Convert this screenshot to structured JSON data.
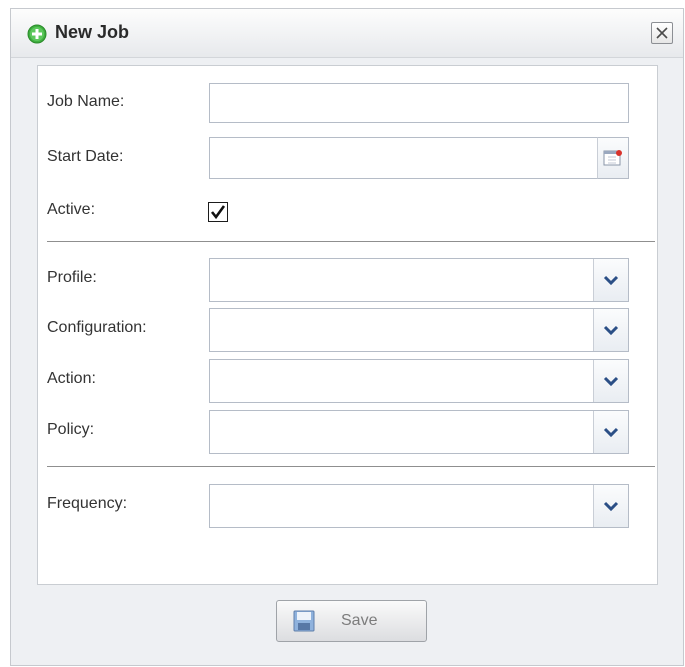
{
  "dialog": {
    "title": "New Job",
    "icon": "add-circle-icon",
    "close_icon": "close-icon"
  },
  "form": {
    "job_name": {
      "label": "Job Name:",
      "value": ""
    },
    "start_date": {
      "label": "Start Date:",
      "value": "",
      "icon": "calendar-icon"
    },
    "active": {
      "label": "Active:",
      "checked": true
    },
    "profile": {
      "label": "Profile:",
      "value": ""
    },
    "configuration": {
      "label": "Configuration:",
      "value": ""
    },
    "action": {
      "label": "Action:",
      "value": ""
    },
    "policy": {
      "label": "Policy:",
      "value": ""
    },
    "frequency": {
      "label": "Frequency:",
      "value": ""
    }
  },
  "footer": {
    "save_label": "Save",
    "save_icon": "floppy-disk-icon"
  },
  "colors": {
    "title_icon_green": "#3fae3f",
    "trigger_arrow": "#2b4f86",
    "field_border": "#b5bcc7"
  }
}
